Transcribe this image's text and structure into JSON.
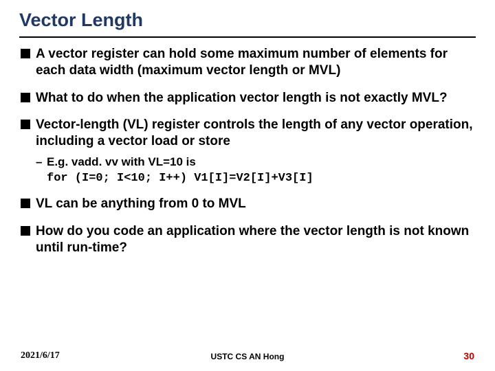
{
  "title": "Vector Length",
  "bullets": {
    "b1": "A vector register can hold some maximum number of elements for each data width (maximum vector length or MVL)",
    "b2": "What to do when the application vector length is not exactly MVL?",
    "b3": "Vector-length (VL) register controls the length of any vector operation, including a vector load or store",
    "b3_sub1": "E.g. vadd. vv with VL=10 is",
    "b3_code": "for (I=0; I<10; I++) V1[I]=V2[I]+V3[I]",
    "b4": "VL can be anything from 0 to MVL",
    "b5": "How do you code an application where the vector length is not known until run-time?"
  },
  "footer": {
    "date": "2021/6/17",
    "center": "USTC CS AN Hong",
    "page": "30"
  }
}
